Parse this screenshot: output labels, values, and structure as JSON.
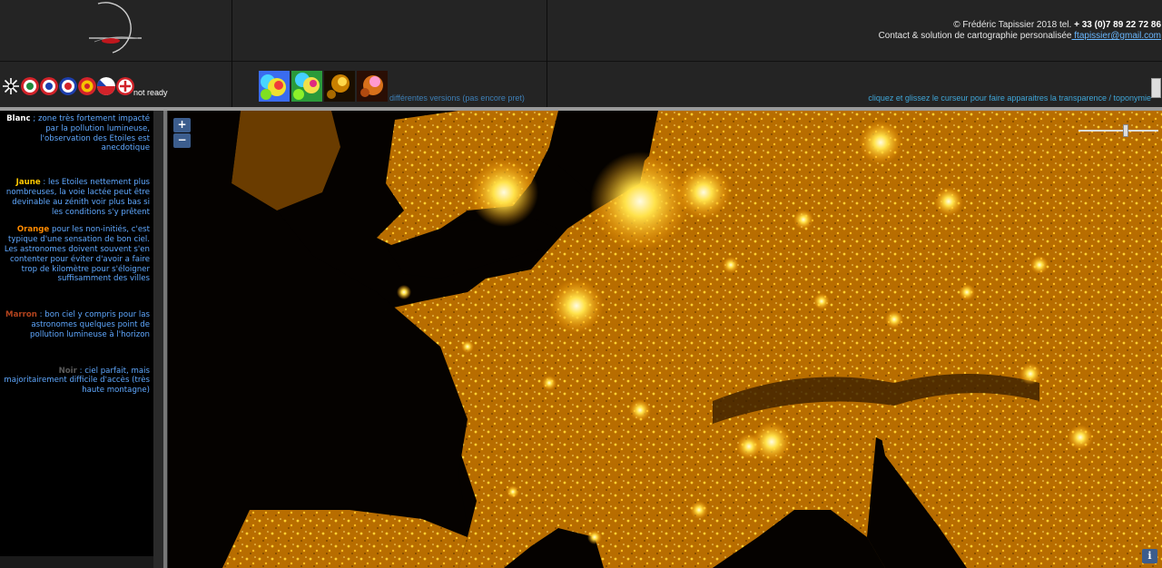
{
  "header": {
    "copyright": "© Frédéric Tapissier 2018  tel.",
    "phone": " + 33  (0)7 89 22 72 86",
    "contact_text": "Contact & solution de cartographie personalisée",
    "email": " ftapissier@gmail.com",
    "logo_icon": "comet-logo-icon"
  },
  "toolbar": {
    "flags": [
      {
        "name": "flag-wheel",
        "icon": "wheel-icon"
      },
      {
        "name": "flag-italy",
        "colors": [
          "#1f8a3c",
          "#ffffff",
          "#d2232a"
        ]
      },
      {
        "name": "flag-france",
        "colors": [
          "#1d3fae",
          "#ffffff",
          "#d2232a"
        ]
      },
      {
        "name": "flag-uk",
        "colors": [
          "#1d3fae",
          "#ffffff",
          "#d2232a"
        ]
      },
      {
        "name": "flag-spain",
        "colors": [
          "#d2232a",
          "#f5c400",
          "#d2232a"
        ]
      },
      {
        "name": "flag-czech",
        "colors": [
          "#1d3fae",
          "#ffffff",
          "#d2232a"
        ]
      },
      {
        "name": "flag-portugal",
        "colors": [
          "#d2232a",
          "#ffffff",
          "#d2232a"
        ]
      }
    ],
    "not_ready": "not ready",
    "versions_label": "différentes versions (pas encore pret)",
    "thumbnails": [
      "version-1-thumbnail",
      "version-2-thumbnail",
      "version-3-thumbnail",
      "version-4-thumbnail"
    ],
    "hint": "cliquez et glissez le curseur pour faire apparaitres la transparence / toponymie"
  },
  "legend": [
    {
      "keyword": "Blanc",
      "color": "#ffffff",
      "text": " ; zone très fortement impacté par la pollution lumineuse, l'observation des Etoiles est anecdotique"
    },
    {
      "keyword": "Jaune",
      "color": "#ffc800",
      "text": " : les Etoiles nettement plus nombreuses, la voie lactée peut être devinable au zénith voir plus bas si les conditions s'y prêtent"
    },
    {
      "keyword": "Orange",
      "color": "#ff8a00",
      "text": " pour les non-initiés, c'est typique d'une sensation de bon ciel. Les astronomes doivent souvent s'en contenter pour éviter d'avoir a faire trop de kilomètre pour s'éloigner suffisamment des villes"
    },
    {
      "keyword": "Marron",
      "color": "#b3431d",
      "text": " : bon ciel y compris pour las astronomes quelques point de pollution lumineuse à l'horizon"
    },
    {
      "keyword": "Noir",
      "color": "#5a5a5a",
      "text": " :  ciel parfait, mais majoritairement difficile d'accès (très haute montagne)"
    }
  ],
  "map": {
    "zoom_in": "+",
    "zoom_out": "−",
    "info": "i",
    "transparency_level": 0.6
  }
}
